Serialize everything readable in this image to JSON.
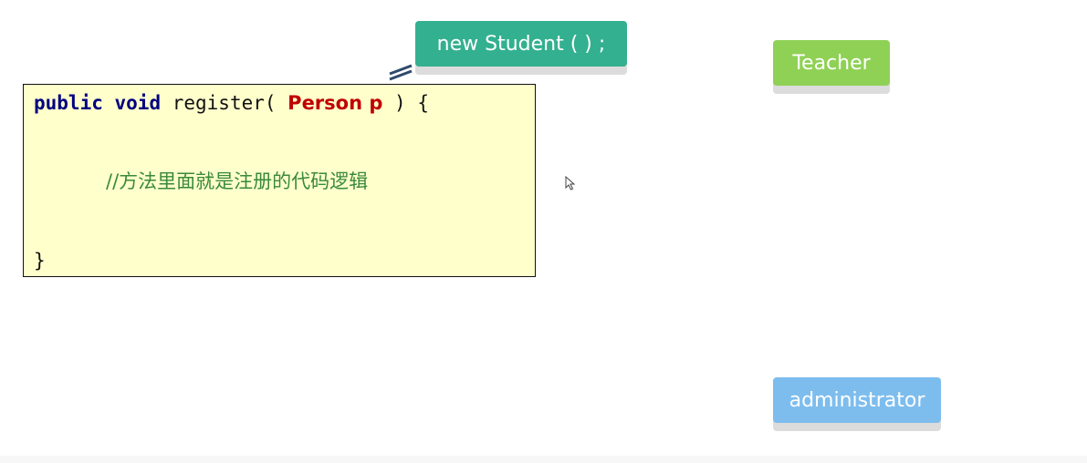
{
  "code": {
    "line1_kw1": "public",
    "line1_kw2": "void",
    "line1_name": " register( ",
    "line1_type": "Person p",
    "line1_end": " ) {",
    "comment": "//方法里面就是注册的代码逻辑",
    "closing_brace": "}"
  },
  "callouts": {
    "student": "new Student ( ) ;",
    "teacher": "Teacher",
    "administrator": "administrator"
  },
  "colors": {
    "code_background": "#ffffcc",
    "keyword": "#000080",
    "type": "#c00000",
    "comment": "#3a8a3a",
    "student": "#33b08f",
    "teacher": "#8fd155",
    "administrator": "#7dbdee"
  },
  "icons": {
    "connector": "connector-lines-icon",
    "cursor": "mouse-cursor-icon"
  }
}
